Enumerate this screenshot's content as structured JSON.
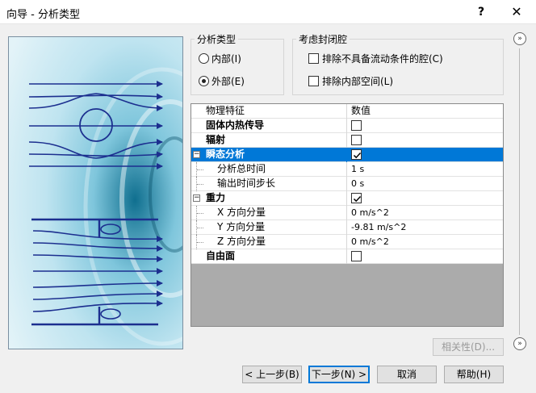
{
  "window": {
    "title": "向导 - 分析类型",
    "help_label": "?",
    "close_label": "✕"
  },
  "analysis_type": {
    "legend": "分析类型",
    "options": [
      {
        "label": "内部(I)",
        "selected": false
      },
      {
        "label": "外部(E)",
        "selected": true
      }
    ]
  },
  "closed_cavities": {
    "legend": "考虑封闭腔",
    "options": [
      {
        "label": "排除不具备流动条件的腔(C)",
        "checked": false
      },
      {
        "label": "排除内部空间(L)",
        "checked": false
      }
    ]
  },
  "property_grid": {
    "header": {
      "name": "物理特征",
      "value": "数值"
    },
    "rows": [
      {
        "name": "固体内热传导",
        "value_type": "checkbox",
        "checked": false
      },
      {
        "name": "辐射",
        "value_type": "checkbox",
        "checked": false
      },
      {
        "name": "瞬态分析",
        "value_type": "checkbox",
        "checked": true,
        "expanded": true,
        "selected": true,
        "expander": "−"
      },
      {
        "name": "分析总时间",
        "value": "1 s"
      },
      {
        "name": "输出时间步长",
        "value": "0 s"
      },
      {
        "name": "重力",
        "value_type": "checkbox",
        "checked": true,
        "expanded": true,
        "expander": "−"
      },
      {
        "name": "X 方向分量",
        "value": "0 m/s^2"
      },
      {
        "name": "Y 方向分量",
        "value": "-9.81 m/s^2"
      },
      {
        "name": "Z 方向分量",
        "value": "0 m/s^2"
      },
      {
        "name": "自由面",
        "value_type": "checkbox",
        "checked": false
      }
    ]
  },
  "buttons": {
    "dependency": "相关性(D)...",
    "back": "< 上一步(B)",
    "next": "下一步(N) >",
    "cancel": "取消",
    "help": "帮助(H)"
  },
  "nav": {
    "up": "»",
    "down": "»"
  },
  "colors": {
    "selection": "#0078d7",
    "illustration_bg": "#bfe4f0",
    "flow_lines": "#1c2f8f"
  }
}
